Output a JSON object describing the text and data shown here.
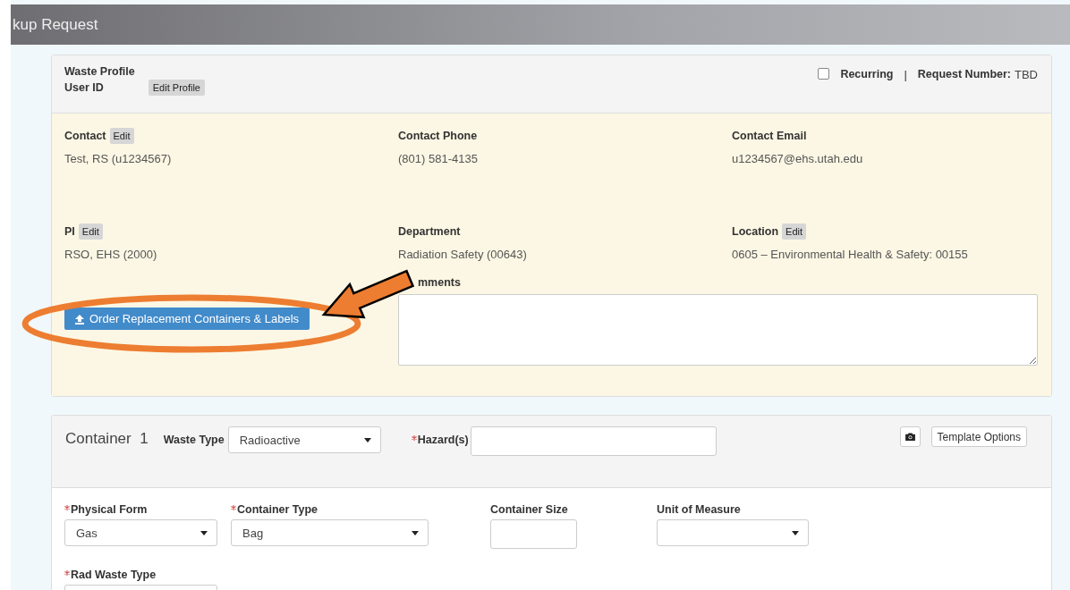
{
  "header": {
    "title": "kup Request"
  },
  "profile": {
    "title": "Waste Profile",
    "user_id_label": "User ID",
    "edit_button": "Edit Profile",
    "recurring": {
      "label": "Recurring",
      "checked": false
    },
    "separator": "|",
    "request_number_label": "Request Number:",
    "request_number": "TBD"
  },
  "contact_fields": [
    {
      "label": "Contact",
      "edit": "Edit",
      "value": "Test, RS (u1234567)"
    },
    {
      "label": "Contact Phone",
      "value": "(801) 581-4135"
    },
    {
      "label": "Contact Email",
      "value": "u1234567@ehs.utah.edu"
    },
    {
      "label": "PI",
      "edit": "Edit",
      "value": "RSO, EHS (2000)"
    },
    {
      "label": "Department",
      "value": "Radiation Safety (00643)"
    },
    {
      "label": "Location",
      "edit": "Edit",
      "value": "0605 – Environmental Health & Safety: 00155"
    }
  ],
  "replacement_button": "Order Replacement Containers & Labels",
  "comments": {
    "label": "mments"
  },
  "container": {
    "title": "Container",
    "number": "1",
    "waste_type": {
      "label": "Waste Type",
      "value": "Radioactive"
    },
    "hazards": {
      "label": "Hazard(s)",
      "required": true
    },
    "template_button": "Template Options",
    "fields": [
      {
        "label": "Physical Form",
        "required": true,
        "kind": "select",
        "value": "Gas"
      },
      {
        "label": "Container Type",
        "required": true,
        "kind": "select",
        "value": "Bag"
      },
      {
        "label": "Container Size",
        "required": false,
        "kind": "text"
      },
      {
        "label": "Unit of Measure",
        "required": false,
        "kind": "select"
      }
    ],
    "rad_waste_type": {
      "label": "Rad Waste Type",
      "required": true
    }
  }
}
